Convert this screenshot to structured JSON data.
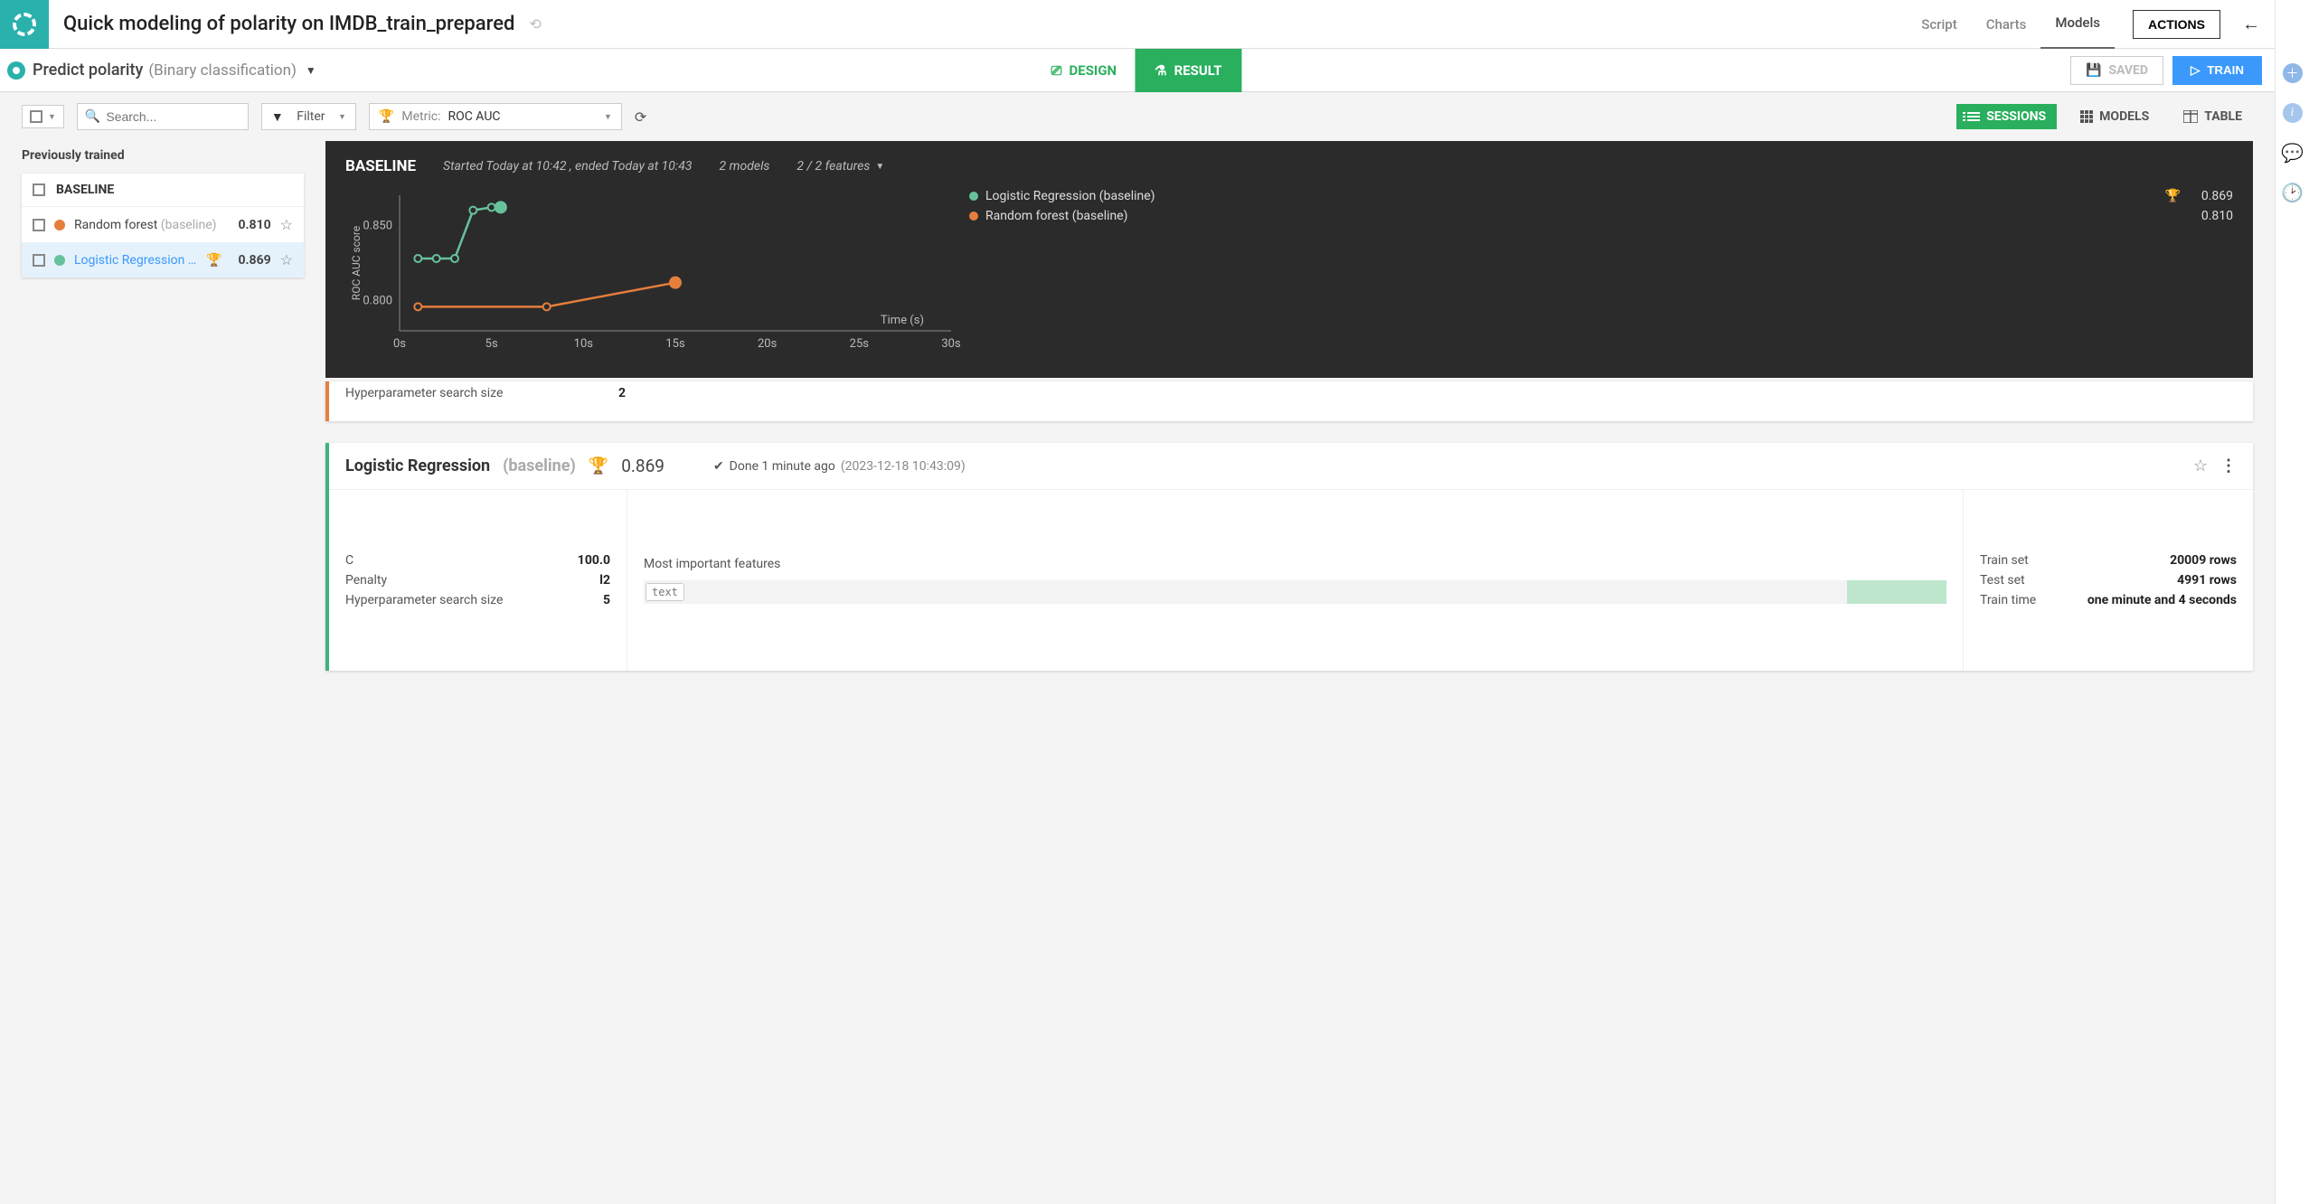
{
  "header": {
    "title": "Quick modeling of polarity on IMDB_train_prepared",
    "tabs": {
      "script": "Script",
      "charts": "Charts",
      "models": "Models"
    },
    "actions_label": "ACTIONS"
  },
  "subheader": {
    "predict_label": "Predict polarity",
    "predict_type": "(Binary classification)",
    "design_label": "DESIGN",
    "result_label": "RESULT",
    "saved_label": "SAVED",
    "train_label": "TRAIN"
  },
  "toolbar": {
    "search_placeholder": "Search...",
    "filter_label": "Filter",
    "metric_prefix": "Metric:",
    "metric_value": "ROC AUC",
    "views": {
      "sessions": "SESSIONS",
      "models": "MODELS",
      "table": "TABLE"
    }
  },
  "sidebar": {
    "title": "Previously trained",
    "baseline_label": "BASELINE",
    "rows": [
      {
        "name": "Random forest",
        "suffix": "(baseline)",
        "score": "0.810"
      },
      {
        "name": "Logistic Regression …",
        "suffix": "",
        "score": "0.869"
      }
    ]
  },
  "baseline_panel": {
    "title": "BASELINE",
    "subtitle": "Started Today at 10:42 , ended Today at 10:43",
    "models_count": "2 models",
    "features_count": "2 / 2 features",
    "legend": [
      {
        "name": "Logistic Regression (baseline)",
        "score": "0.869",
        "trophy": true,
        "color": "#67c29c"
      },
      {
        "name": "Random forest (baseline)",
        "score": "0.810",
        "trophy": false,
        "color": "#e67e3c"
      }
    ]
  },
  "chart_data": {
    "type": "line",
    "title": "",
    "xlabel": "Time (s)",
    "ylabel": "ROC AUC score",
    "xlim": [
      0,
      30
    ],
    "ylim": [
      0.78,
      0.87
    ],
    "xticks": [
      "0s",
      "5s",
      "10s",
      "15s",
      "20s",
      "25s",
      "30s"
    ],
    "yticks": [
      0.8,
      0.85
    ],
    "series": [
      {
        "name": "Logistic Regression (baseline)",
        "color": "#67c29c",
        "x": [
          1,
          2,
          3,
          4,
          5,
          5.5
        ],
        "y": [
          0.828,
          0.828,
          0.828,
          0.86,
          0.862,
          0.862
        ],
        "final_point": {
          "x": 5.5,
          "y": 0.862
        }
      },
      {
        "name": "Random forest (baseline)",
        "color": "#e67e3c",
        "x": [
          1,
          8,
          15
        ],
        "y": [
          0.796,
          0.796,
          0.812
        ],
        "final_point": {
          "x": 15,
          "y": 0.812
        }
      }
    ]
  },
  "truncated_card": {
    "param_label": "Hyperparameter search size",
    "param_value": "2"
  },
  "log_card": {
    "title": "Logistic Regression",
    "title_suffix": "(baseline)",
    "score": "0.869",
    "done_prefix": "Done 1 minute ago",
    "done_ts": "(2023-12-18 10:43:09)",
    "params": [
      {
        "label": "C",
        "value": "100.0"
      },
      {
        "label": "Penalty",
        "value": "l2"
      },
      {
        "label": "Hyperparameter search size",
        "value": "5"
      }
    ],
    "mif_title": "Most important features",
    "feature_name": "text",
    "stats": [
      {
        "label": "Train set",
        "value": "20009 rows"
      },
      {
        "label": "Test set",
        "value": "4991 rows"
      },
      {
        "label": "Train time",
        "value": "one minute and 4 seconds"
      }
    ]
  }
}
